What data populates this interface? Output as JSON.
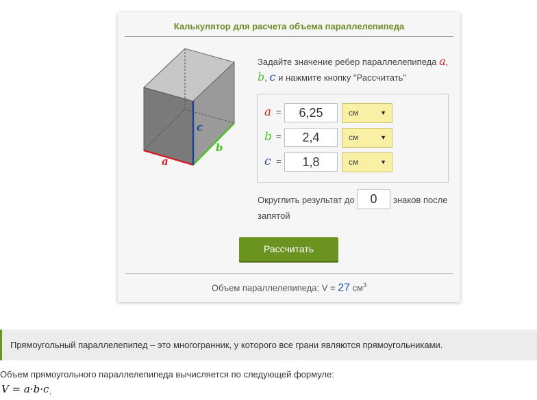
{
  "calculator": {
    "title": "Калькулятор для расчета объема параллелепипеда",
    "instructions": {
      "text_before": "Задайте значение ребер параллелепипеда ",
      "var_a": "a",
      "comma1": ",",
      "var_b": "b",
      "comma2": ",",
      "var_c": "c",
      "text_after": " и нажмите кнопку \"Рассчитать\""
    },
    "inputs": [
      {
        "var": "a",
        "eq": "=",
        "value": "6,25",
        "unit": "см"
      },
      {
        "var": "b",
        "eq": "=",
        "value": "2,4",
        "unit": "см"
      },
      {
        "var": "c",
        "eq": "=",
        "value": "1,8",
        "unit": "см"
      }
    ],
    "rounding": {
      "prefix": "Округлить результат до",
      "value": "0",
      "suffix": "знаков после",
      "suffix2": "запятой"
    },
    "button_label": "Рассчитать",
    "result": {
      "label": "Объем параллелепипеда: V = ",
      "value": "27",
      "unit": "см",
      "unit_sup": "3"
    },
    "diagram_labels": {
      "a": "a",
      "b": "b",
      "c": "c"
    }
  },
  "article": {
    "note": "Прямоугольный параллелепипед – это многогранник, у которого все грани являются прямоугольниками.",
    "formula_intro": "Объем прямоугольного параллелепипеда вычисляется по следующей формуле:",
    "formula": "V = a·b·c",
    "formula_comma": ","
  },
  "colors": {
    "accent": "#6b9320",
    "title": "#6c8a25",
    "edge_a": "#d0242b",
    "edge_b": "#4dbf2a",
    "edge_c": "#2440a0",
    "select_bg": "#f9f0a6"
  },
  "icons": {
    "dropdown": "triangle-down"
  }
}
